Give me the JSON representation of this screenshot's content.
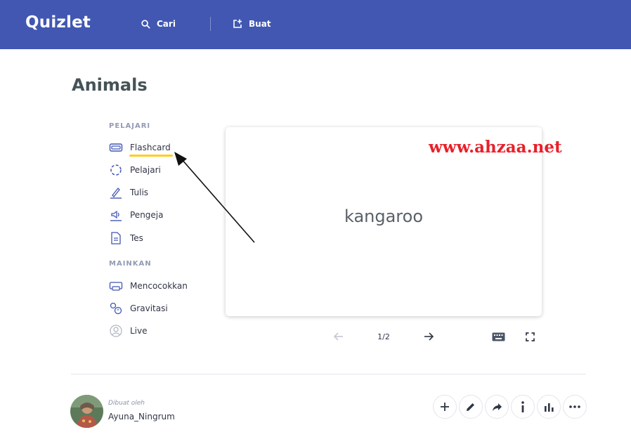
{
  "header": {
    "logo": "Quizlet",
    "search_label": "Cari",
    "create_label": "Buat"
  },
  "set": {
    "title": "Animals"
  },
  "study_modes": {
    "learn_section": "PELAJARI",
    "learn_items": [
      {
        "label": "Flashcard",
        "icon": "flashcard-icon",
        "active": true
      },
      {
        "label": "Pelajari",
        "icon": "learn-icon"
      },
      {
        "label": "Tulis",
        "icon": "write-icon"
      },
      {
        "label": "Pengeja",
        "icon": "spell-icon"
      },
      {
        "label": "Tes",
        "icon": "test-icon"
      }
    ],
    "play_section": "MAINKAN",
    "play_items": [
      {
        "label": "Mencocokkan",
        "icon": "match-icon"
      },
      {
        "label": "Gravitasi",
        "icon": "gravity-icon"
      },
      {
        "label": "Live",
        "icon": "live-icon"
      }
    ]
  },
  "flashcard": {
    "term": "kangaroo",
    "counter": "1/2",
    "current": 1,
    "total": 2
  },
  "watermark": "www.ahzaa.net",
  "creator": {
    "label": "Dibuat oleh",
    "name": "Ayuna_Ningrum"
  },
  "actions": [
    "add-icon",
    "edit-icon",
    "share-icon",
    "info-icon",
    "stats-icon",
    "more-icon"
  ],
  "colors": {
    "header_bg": "#4257b2",
    "active_underline": "#ffcd1f",
    "watermark": "#e8202a",
    "text_dark": "#303545"
  }
}
